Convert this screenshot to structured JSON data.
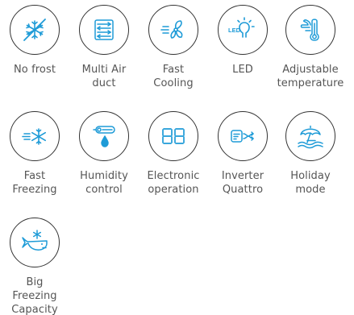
{
  "colors": {
    "icon": "#1e9bd7",
    "circle_border": "#333333",
    "text": "#555555"
  },
  "features": [
    {
      "icon": "no-frost-icon",
      "label_lines": [
        "No frost"
      ]
    },
    {
      "icon": "multi-air-duct-icon",
      "label_lines": [
        "Multi Air",
        "duct"
      ]
    },
    {
      "icon": "fast-cooling-icon",
      "label_lines": [
        "Fast",
        "Cooling"
      ]
    },
    {
      "icon": "led-icon",
      "icon_text": "LED",
      "label_lines": [
        "LED"
      ]
    },
    {
      "icon": "adjustable-temperature-icon",
      "label_lines": [
        "Adjustable",
        "temperature"
      ]
    },
    {
      "icon": "fast-freezing-icon",
      "label_lines": [
        "Fast",
        "Freezing"
      ]
    },
    {
      "icon": "humidity-control-icon",
      "label_lines": [
        "Humidity",
        "control"
      ]
    },
    {
      "icon": "electronic-operation-icon",
      "label_lines": [
        "Electronic",
        "operation"
      ]
    },
    {
      "icon": "inverter-quattro-icon",
      "label_lines": [
        "Inverter",
        "Quattro"
      ]
    },
    {
      "icon": "holiday-mode-icon",
      "label_lines": [
        "Holiday",
        "mode"
      ]
    },
    {
      "icon": "big-freezing-capacity-icon",
      "label_lines": [
        "Big",
        "Freezing",
        "Capacity"
      ]
    }
  ]
}
